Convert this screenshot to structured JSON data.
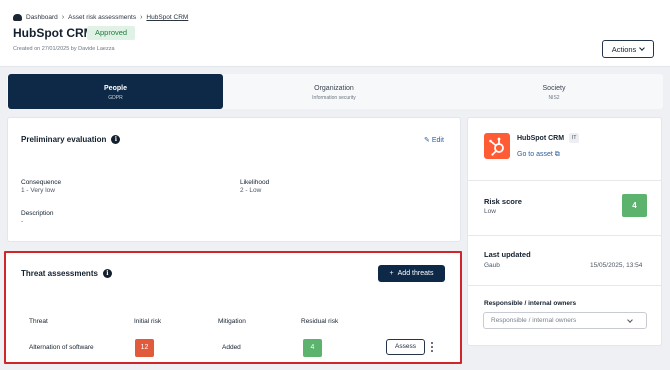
{
  "breadcrumb": [
    {
      "label": "Dashboard",
      "icon": "dashboard-icon"
    },
    {
      "label": "Asset risk assessments"
    },
    {
      "label": "HubSpot CRM"
    }
  ],
  "page": {
    "title": "HubSpot CRM",
    "status": "Approved",
    "created": "Created on 27/01/2025 by Davide Laezza",
    "actions_label": "Actions"
  },
  "tabs": [
    {
      "label": "People",
      "sub": "GDPR",
      "active": true
    },
    {
      "label": "Organization",
      "sub": "Information security",
      "active": false
    },
    {
      "label": "Society",
      "sub": "NIS2",
      "active": false
    }
  ],
  "preliminary": {
    "title": "Preliminary evaluation",
    "edit_label": "Edit",
    "consequence_label": "Consequence",
    "consequence_value": "1 - Very low",
    "likelihood_label": "Likelihood",
    "likelihood_value": "2 - Low",
    "description_label": "Description",
    "description_value": "-"
  },
  "threats": {
    "title": "Threat assessments",
    "add_label": "Add threats",
    "columns": [
      "Threat",
      "Initial risk",
      "Mitigation",
      "Residual risk"
    ],
    "rows": [
      {
        "threat": "Alternation of software",
        "initial_risk": "12",
        "mitigation": "Added",
        "residual_risk": "4",
        "assess_label": "Assess"
      }
    ]
  },
  "asset": {
    "name": "HubSpot CRM",
    "badge": "IT",
    "goto_label": "Go to asset",
    "risk_score_label": "Risk score",
    "risk_score_level": "Low",
    "risk_score_value": "4",
    "last_updated_label": "Last updated",
    "last_updated_by": "Gaub",
    "last_updated_date": "15/05/2025, 13:54",
    "owners_label": "Responsible / internal owners",
    "owners_placeholder": "Responsible / internal owners"
  },
  "colors": {
    "primary": "#0e2947",
    "risk_high": "#e05a3b",
    "risk_low": "#5cb36e",
    "hubspot": "#ff5c35",
    "highlight_border": "#d0262a"
  }
}
